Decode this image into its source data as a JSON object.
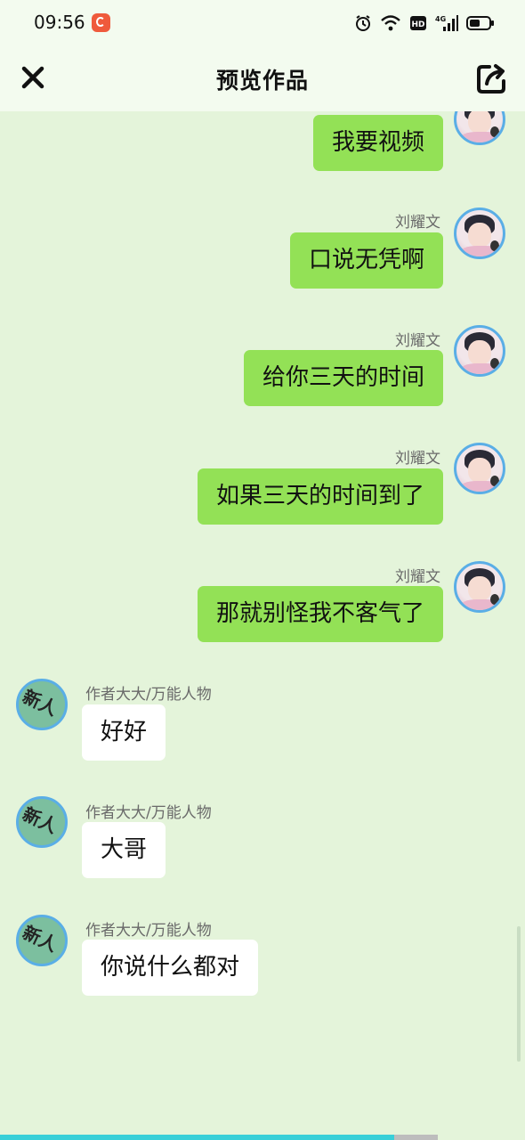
{
  "status_bar": {
    "time": "09:56",
    "icons": [
      "alarm-icon",
      "wifi-icon",
      "hd-icon",
      "signal-4g-icon",
      "battery-icon"
    ],
    "network_label": "4G",
    "hd_label": "HD",
    "battery_level": 0.55
  },
  "header": {
    "title": "预览作品",
    "close_icon": "close-icon",
    "share_icon": "share-icon"
  },
  "messages": [
    {
      "side": "right",
      "sender": "",
      "text": "我要视频"
    },
    {
      "side": "right",
      "sender": "刘耀文",
      "text": "口说无凭啊"
    },
    {
      "side": "right",
      "sender": "刘耀文",
      "text": "给你三天的时间"
    },
    {
      "side": "right",
      "sender": "刘耀文",
      "text": "如果三天的时间到了"
    },
    {
      "side": "right",
      "sender": "刘耀文",
      "text": "那就别怪我不客气了"
    },
    {
      "side": "left",
      "sender": "作者大大/万能人物",
      "text": "好好"
    },
    {
      "side": "left",
      "sender": "作者大大/万能人物",
      "text": "大哥"
    },
    {
      "side": "left",
      "sender": "作者大大/万能人物",
      "text": "你说什么都对"
    }
  ],
  "avatar_left_text": "新人",
  "colors": {
    "background": "#e4f4da",
    "bubble_right": "#93e156",
    "bubble_left": "#ffffff",
    "avatar_border": "#5aaee6",
    "progress": "#38cfd8"
  },
  "progress": {
    "value": 0.9
  }
}
